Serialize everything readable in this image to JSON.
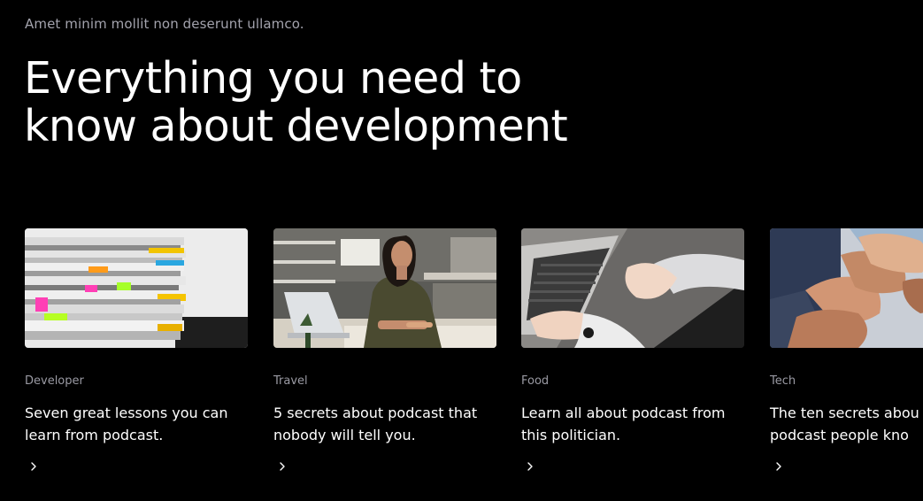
{
  "header": {
    "eyebrow": "Amet minim mollit non deserunt ullamco.",
    "headline_line1": "Everything you need to",
    "headline_line2": "know about development"
  },
  "cards": [
    {
      "category": "Developer",
      "title_line1": "Seven great lessons you can",
      "title_line2": "learn from podcast.",
      "image": "stacked-magazines-photo",
      "arrow": "chevron-right-icon"
    },
    {
      "category": "Travel",
      "title_line1": "5 secrets about podcast that",
      "title_line2": "nobody will tell you.",
      "image": "woman-at-laptop-photo",
      "arrow": "chevron-right-icon"
    },
    {
      "category": "Food",
      "title_line1": "Learn all about podcast from",
      "title_line2": "this politician.",
      "image": "hands-typing-laptop-photo",
      "arrow": "chevron-right-icon"
    },
    {
      "category": "Tech",
      "title_line1": "The ten secrets abou",
      "title_line2": "podcast people kno",
      "image": "stacked-hands-photo",
      "arrow": "chevron-right-icon"
    }
  ],
  "colors": {
    "background": "#000000",
    "text": "#ffffff",
    "muted": "#9a9aa3"
  }
}
